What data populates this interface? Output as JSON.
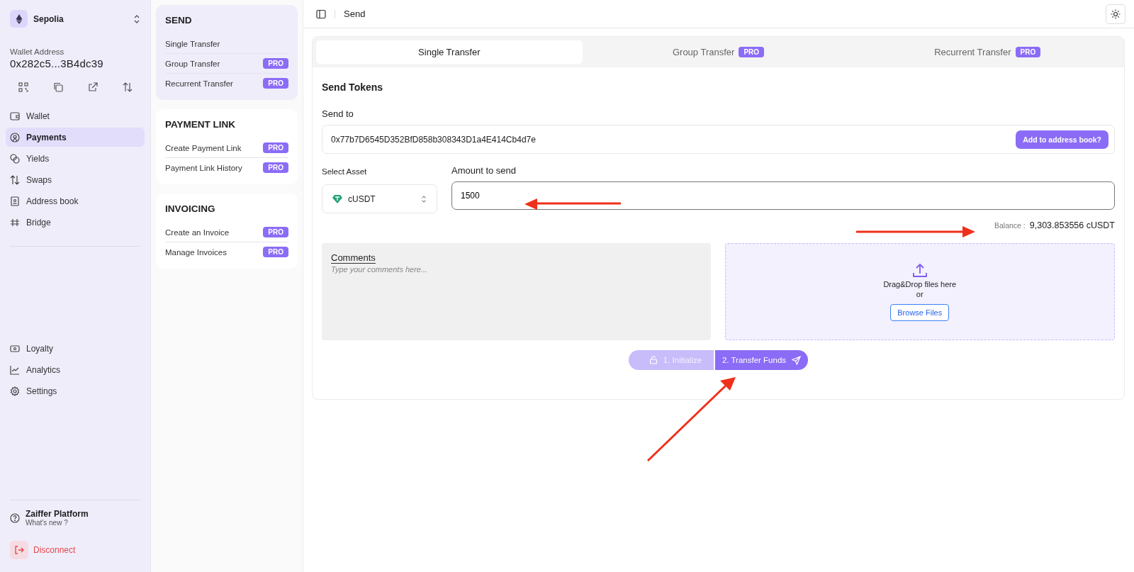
{
  "sidebar": {
    "network": "Sepolia",
    "wallet_label": "Wallet Address",
    "wallet_address": "0x282c5...3B4dc39",
    "nav_top": [
      {
        "label": "Wallet",
        "kind": "wallet",
        "selected": false
      },
      {
        "label": "Payments",
        "kind": "payments",
        "selected": true
      },
      {
        "label": "Yields",
        "kind": "yields",
        "selected": false
      },
      {
        "label": "Swaps",
        "kind": "swaps",
        "selected": false
      },
      {
        "label": "Address book",
        "kind": "book",
        "selected": false
      },
      {
        "label": "Bridge",
        "kind": "bridge",
        "selected": false
      }
    ],
    "nav_bottom": [
      {
        "label": "Loyalty",
        "kind": "loyalty",
        "selected": false
      },
      {
        "label": "Analytics",
        "kind": "analytics",
        "selected": false
      },
      {
        "label": "Settings",
        "kind": "settings",
        "selected": false
      }
    ],
    "platform": {
      "title": "Zaiffer Platform",
      "subtitle": "What's new ?"
    },
    "disconnect": "Disconnect"
  },
  "menu": [
    {
      "title": "SEND",
      "selected": true,
      "items": [
        {
          "label": "Single Transfer"
        },
        {
          "label": "Group Transfer",
          "badge": "PRO"
        },
        {
          "label": "Recurrent Transfer",
          "badge": "PRO"
        }
      ]
    },
    {
      "title": "PAYMENT LINK",
      "selected": false,
      "items": [
        {
          "label": "Create Payment Link",
          "badge": "PRO"
        },
        {
          "label": "Payment Link History",
          "badge": "PRO"
        }
      ]
    },
    {
      "title": "INVOICING",
      "selected": false,
      "items": [
        {
          "label": "Create an Invoice",
          "badge": "PRO"
        },
        {
          "label": "Manage Invoices",
          "badge": "PRO"
        }
      ]
    }
  ],
  "header": {
    "title": "Send"
  },
  "tabs": [
    {
      "label": "Single Transfer",
      "selected": true
    },
    {
      "label": "Group Transfer",
      "badge": "PRO",
      "selected": false
    },
    {
      "label": "Recurrent Transfer",
      "badge": "PRO",
      "selected": false
    }
  ],
  "form": {
    "title": "Send Tokens",
    "send_to_label": "Send to",
    "send_to_value": "0x77b7D6545D352BfD858b308343D1a4E414Cb4d7e",
    "address_book_button": "Add to address book?",
    "asset_label": "Select Asset",
    "asset_value": "cUSDT",
    "amount_label": "Amount to send",
    "amount_value": "1500",
    "balance_label": "Balance :",
    "balance_value": "9,303.853556 cUSDT",
    "comments_label": "Comments",
    "comments_placeholder": "Type your comments here...",
    "drop_text": "Drag&Drop files here",
    "drop_or": "or",
    "browse_button": "Browse Files",
    "steps": [
      {
        "label": "1. Initialize",
        "kind": "initialize",
        "disabled": true
      },
      {
        "label": "2. Transfer Funds",
        "kind": "transfer",
        "disabled": false
      }
    ]
  }
}
